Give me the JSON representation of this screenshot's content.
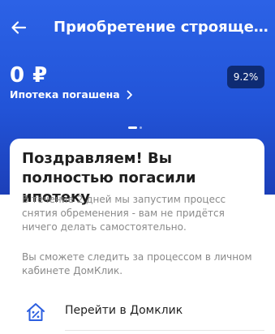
{
  "header": {
    "title": "Приобретение строящегос…",
    "amount": "0 ₽",
    "status_label": "Ипотека погашена",
    "rate_badge": "9.2%"
  },
  "card": {
    "title": "Поздравляем! Вы полностью погасили ипотеку",
    "paragraph1": "В течение 2 дней мы запустим процесс снятия обременения - вам не придётся ничего делать самостоятельно.",
    "paragraph2": "Вы сможете следить за процессом в личном кабинете ДомКлик.",
    "action_label": "Перейти в Домклик"
  },
  "icons": {
    "back": "arrow-left-icon",
    "status_chevron": "chevron-right-icon",
    "action": "house-percent-icon"
  },
  "colors": {
    "header_blue": "#2254d8",
    "badge_bg": "#0e2b73",
    "accent_icon": "#2d5fe0"
  }
}
